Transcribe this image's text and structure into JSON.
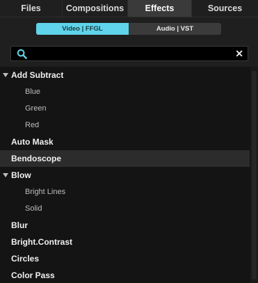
{
  "tabs": [
    {
      "label": "Files"
    },
    {
      "label": "Compositions"
    },
    {
      "label": "Effects"
    },
    {
      "label": "Sources"
    }
  ],
  "active_tab": "Effects",
  "segment": {
    "left": "Video | FFGL",
    "right": "Audio | VST",
    "active": "Video | FFGL"
  },
  "search": {
    "value": "",
    "placeholder": ""
  },
  "icons": {
    "search": "search-icon",
    "clear": "close-icon",
    "expand": "triangle-down-icon"
  },
  "colors": {
    "accent": "#5fd4ea",
    "background": "#141414",
    "selected_row": "#2c2c2c"
  },
  "tree": {
    "rows": [
      {
        "label": "Add Subtract",
        "type": "group",
        "expanded": true
      },
      {
        "label": "Blue",
        "type": "child"
      },
      {
        "label": "Green",
        "type": "child"
      },
      {
        "label": "Red",
        "type": "child"
      },
      {
        "label": "Auto Mask",
        "type": "item"
      },
      {
        "label": "Bendoscope",
        "type": "item",
        "selected": true
      },
      {
        "label": "Blow",
        "type": "group",
        "expanded": true
      },
      {
        "label": "Bright Lines",
        "type": "child"
      },
      {
        "label": "Solid",
        "type": "child"
      },
      {
        "label": "Blur",
        "type": "item"
      },
      {
        "label": "Bright.Contrast",
        "type": "item"
      },
      {
        "label": "Circles",
        "type": "item"
      },
      {
        "label": "Color Pass",
        "type": "item"
      }
    ]
  }
}
